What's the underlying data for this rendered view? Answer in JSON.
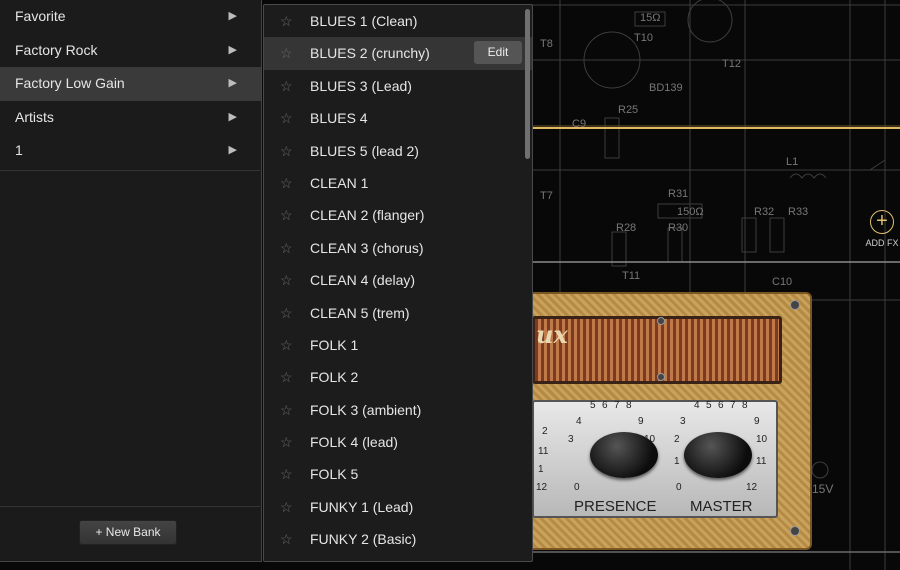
{
  "banks": {
    "items": [
      {
        "label": "Favorite"
      },
      {
        "label": "Factory Rock"
      },
      {
        "label": "Factory Low Gain",
        "selected": true
      },
      {
        "label": "Artists"
      },
      {
        "label": "1"
      }
    ],
    "new_bank_label": "+ New Bank"
  },
  "presets": {
    "items": [
      "BLUES 1 (Clean)",
      "BLUES 2 (crunchy)",
      "BLUES 3 (Lead)",
      "BLUES 4",
      "BLUES 5 (lead 2)",
      "CLEAN 1",
      "CLEAN 2 (flanger)",
      "CLEAN 3 (chorus)",
      "CLEAN 4 (delay)",
      "CLEAN 5 (trem)",
      "FOLK 1",
      "FOLK 2",
      "FOLK 3 (ambient)",
      "FOLK 4 (lead)",
      "FOLK 5",
      "FUNKY 1 (Lead)",
      "FUNKY 2 (Basic)"
    ],
    "hovered_index": 1,
    "edit_label": "Edit"
  },
  "background": {
    "add_fx_label": "ADD FX",
    "amp_logo": "ux",
    "knob_presence": "PRESENCE",
    "knob_master": "MASTER",
    "scale_presence": [
      "5",
      "6",
      "7",
      "8",
      "4",
      "9",
      "3",
      "10",
      "2",
      "11",
      "1",
      "12",
      "0"
    ],
    "scale_master": [
      "4",
      "5",
      "6",
      "7",
      "8",
      "3",
      "9",
      "2",
      "10",
      "1",
      "11",
      "0",
      "12"
    ],
    "schematic_labels": [
      "BD139",
      "T8",
      "T10",
      "T12",
      "R25",
      "C9",
      "L1",
      "R31",
      "R32",
      "R33",
      "R28",
      "R30",
      "T11",
      "C10",
      "T7",
      "15Ω",
      "150Ω",
      "15V"
    ]
  },
  "colors": {
    "menu_bg": "#1b1b1b",
    "selected_bg": "#3a3a3a",
    "accent_gold": "#e0c070"
  }
}
